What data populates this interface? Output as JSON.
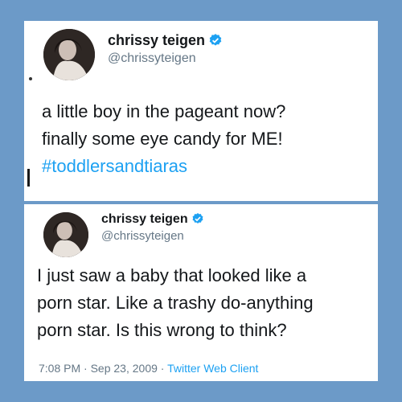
{
  "tweets": [
    {
      "user": {
        "name": "chrissy teigen",
        "handle": "@chrissyteigen",
        "verified_icon": "verified-badge-icon"
      },
      "text_main": "a little boy in the pageant now?\nfinally some eye candy for ME!",
      "hashtag": "#toddlersandtiaras"
    },
    {
      "user": {
        "name": "chrissy teigen",
        "handle": "@chrissyteigen",
        "verified_icon": "verified-badge-icon"
      },
      "text_main": "I just saw a baby that looked like a\nporn star. Like a trashy do-anything\nporn star. Is this wrong to think?",
      "meta": {
        "time": "7:08 PM",
        "separator": "·",
        "date": "Sep 23, 2009",
        "client": "Twitter Web Client"
      }
    }
  ],
  "colors": {
    "background": "#6c9ac8",
    "link": "#1da1f2",
    "verified": "#1da1f2",
    "text": "#14171a",
    "secondary": "#657786"
  }
}
